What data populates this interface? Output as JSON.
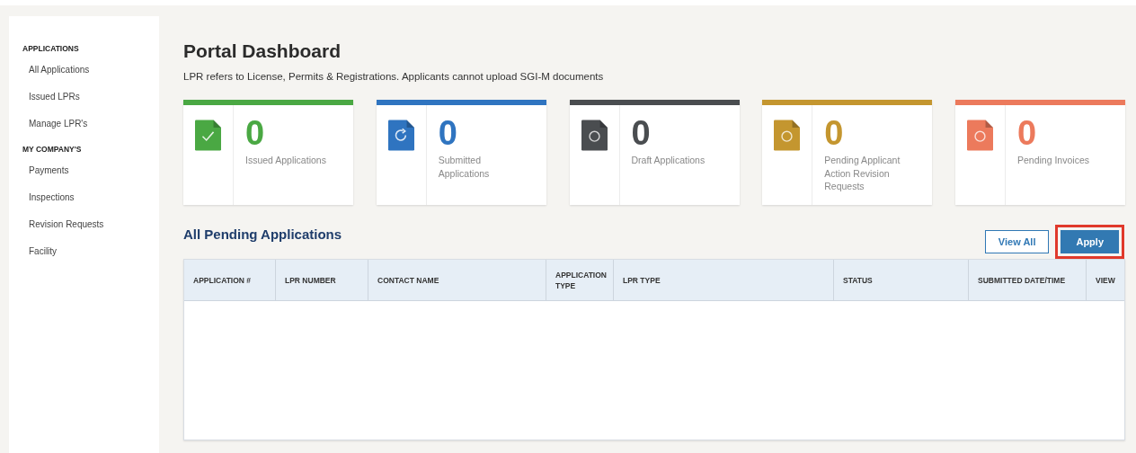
{
  "sidebar": {
    "sections": [
      {
        "heading": "APPLICATIONS",
        "items": [
          {
            "label": "All Applications"
          },
          {
            "label": "Issued LPRs"
          },
          {
            "label": "Manage LPR's"
          }
        ]
      },
      {
        "heading": "MY COMPANY'S",
        "items": [
          {
            "label": "Payments"
          },
          {
            "label": "Inspections"
          },
          {
            "label": "Revision Requests"
          },
          {
            "label": "Facility"
          }
        ]
      }
    ]
  },
  "page": {
    "title": "Portal Dashboard",
    "subtitle": "LPR refers to License, Permits & Registrations. Applicants cannot upload SGI-M documents"
  },
  "cards": [
    {
      "count": "0",
      "label": "Issued Applications",
      "color": "#4aa843",
      "kind": "issued"
    },
    {
      "count": "0",
      "label": "Submitted Applications",
      "color": "#2f74c0",
      "kind": "submitted"
    },
    {
      "count": "0",
      "label": "Draft Applications",
      "color": "#4a4d50",
      "kind": "pending"
    },
    {
      "count": "0",
      "label": "Pending Applicant Action Revision Requests",
      "color": "#c4962f",
      "kind": "pending"
    },
    {
      "count": "0",
      "label": "Pending Invoices",
      "color": "#ec7a5c",
      "kind": "pending"
    }
  ],
  "pending": {
    "title": "All Pending Applications",
    "buttons": [
      {
        "label": "View All",
        "kind": "outline",
        "highlighted": false
      },
      {
        "label": "Apply",
        "kind": "primary",
        "highlighted": true
      }
    ],
    "table": {
      "columns": [
        "APPLICATION #",
        "LPR NUMBER",
        "CONTACT NAME",
        "APPLICATION TYPE",
        "LPR TYPE",
        "STATUS",
        "SUBMITTED DATE/TIME",
        "VIEW"
      ]
    }
  }
}
